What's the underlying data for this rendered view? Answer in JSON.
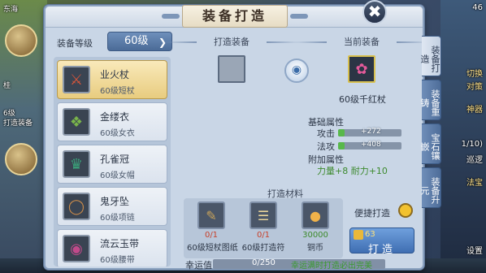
{
  "background": {
    "left_texts": [
      "东海",
      "桂",
      "6级",
      "打造装备",
      "回"
    ],
    "right_texts": [
      "46",
      "切换",
      "对策",
      "神器",
      "1/10)",
      "巡逻",
      "法宝",
      "设置"
    ]
  },
  "window": {
    "title": "装备打造"
  },
  "level": {
    "label": "装备等级",
    "selected": "60级"
  },
  "items": [
    {
      "name": "业火杖",
      "type": "60级短杖",
      "icon": "staff-icon",
      "color": "#d9553a"
    },
    {
      "name": "金缕衣",
      "type": "60级女衣",
      "icon": "robe-icon",
      "color": "#7ab44a"
    },
    {
      "name": "孔雀冠",
      "type": "60级女帽",
      "icon": "crown-icon",
      "color": "#3aa37a"
    },
    {
      "name": "鬼牙坠",
      "type": "60级项链",
      "icon": "necklace-icon",
      "color": "#c98a4a"
    },
    {
      "name": "流云玉带",
      "type": "60级腰带",
      "icon": "belt-icon",
      "color": "#c04a8a"
    }
  ],
  "make": {
    "header": "打造装备",
    "current_header": "当前装备",
    "current_name": "60级千红杖",
    "current_icon": "red-staff-icon"
  },
  "attributes": {
    "base_title": "基础属性",
    "rows": [
      {
        "label": "攻击",
        "value": "+272"
      },
      {
        "label": "法攻",
        "value": "+408"
      }
    ],
    "extra_title": "附加属性",
    "bonus": "力量+8  耐力+10"
  },
  "materials": {
    "header": "打造材料",
    "items": [
      {
        "count": "0/1",
        "name": "60级短杖图纸",
        "icon": "blueprint-icon"
      },
      {
        "count": "0/1",
        "name": "60级打造符",
        "icon": "talisman-icon"
      },
      {
        "count": "30000",
        "name": "铜币",
        "icon": "coins-icon"
      }
    ]
  },
  "quick": {
    "label": "便捷打造"
  },
  "action": {
    "cost": "63",
    "label": "打造"
  },
  "luck": {
    "label": "幸运值",
    "value": "0/250",
    "hint": "幸运满时打造必出完美"
  },
  "tabs": [
    {
      "label": "装备打造"
    },
    {
      "label": "装备重铸"
    },
    {
      "label": "宝石镶嵌"
    },
    {
      "label": "装备升元"
    }
  ]
}
